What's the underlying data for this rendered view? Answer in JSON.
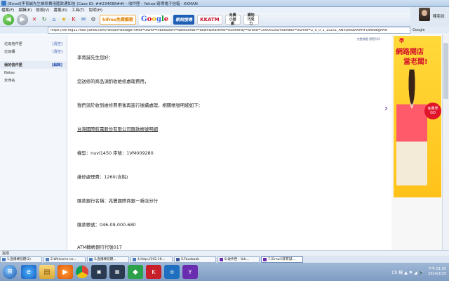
{
  "window": {
    "title": "[Email]李育誠先生維修費用匯款通知信 (Case ID: ##234688##) - 收件匣 - Yahoo!奇摩電子信箱 - KKMAN"
  },
  "menu": [
    "檔案(F)",
    "編輯(E)",
    "檢視(V)",
    "書籤(O)",
    "工具(T)",
    "說明(H)"
  ],
  "toolbar": {
    "logos": {
      "hifree": "hifree免費觀歌",
      "google": "Google",
      "geswing": "歌詞搜尋",
      "kkatm": "KKATM",
      "small1": "免費 小遊戲",
      "small2": "購物 巧克力"
    }
  },
  "address": {
    "url": "https://tw-mg31.mail.yahoo.com/neo/b/message?sMid=0&fid=Inbox&sort=date&order=down&startMid=0&filterBy=&rand=1060633&midIndex=0&mid=2_0_0_1_15251_ANnDeoaAAAHFUwwa8gAAA",
    "search_label": "Google"
  },
  "user": {
    "name": "陳奕如"
  },
  "sidebar": {
    "rows": [
      {
        "label": "垃圾信件匣",
        "action": "[清空]"
      },
      {
        "label": "垃圾桶",
        "action": "[清空]"
      }
    ],
    "folders_head": {
      "label": "我的信件匣",
      "action": "[編輯]"
    },
    "folders": [
      "Notes",
      "未命名"
    ]
  },
  "mail": {
    "top_links": "完整標題  預覽列印",
    "lines": [
      "李育誠先生您好：",
      "您送修的商品須酌收維修處理費用，",
      "我們須於收到維修費用後再進行後續處理，相關帳號明細如下：",
      "台灣國際航電股份有限公司匯款帳號明細",
      "機型：nuvi1450 序號：1VM009280",
      "維修處理費：1260(含稅)",
      "匯款銀行名稱：兆豐國際商銀－新店分行",
      "匯款帳號：046-09-000-680",
      "ATM轉帳銀行代號017"
    ]
  },
  "ad": {
    "top": "學",
    "line1": "網路開店",
    "line2": "當老闆!",
    "badge1": "免費學",
    "badge2": "GO"
  },
  "status": {
    "text": "完成"
  },
  "tabs": [
    {
      "label": "1.直播棒話題(2)",
      "kind": "ie"
    },
    {
      "label": "2.Welcome co...",
      "kind": "ie"
    },
    {
      "label": "3.直播棒話題...",
      "kind": "ie"
    },
    {
      "label": "4.http://192.16...",
      "kind": "ie"
    },
    {
      "label": "5.Facebook",
      "kind": "fb"
    },
    {
      "label": "6.收件匣 - Yah...",
      "kind": "y"
    },
    {
      "label": "7.[Email]李育誠...",
      "kind": "y"
    }
  ],
  "tray": {
    "icons": "Ch 輸 ▲ ⚑ ◢ 🔊",
    "time": "下午 01:05",
    "date": "2014/2/25"
  }
}
